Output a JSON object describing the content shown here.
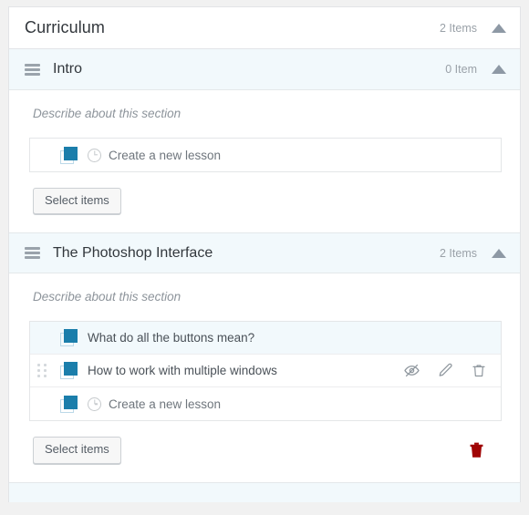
{
  "panel": {
    "title": "Curriculum",
    "item_count": "2 Items",
    "collapse_icon": "caret-up-icon"
  },
  "colors": {
    "book_icon_blue": "#1b7eab",
    "section_header_bg": "#f2f9fc",
    "delete_red": "#a00404",
    "text_primary": "#32373c",
    "text_muted": "#9aa1a8"
  },
  "sections": [
    {
      "title": "Intro",
      "item_count": "0 Item",
      "describe_placeholder": "Describe about this section",
      "lessons": [
        {
          "label": "Create a new lesson",
          "type": "placeholder",
          "has_clock": true,
          "has_handle": false,
          "highlight": false,
          "actions": []
        }
      ],
      "select_items_label": "Select items",
      "has_delete_button": false
    },
    {
      "title": "The Photoshop Interface",
      "item_count": "2 Items",
      "describe_placeholder": "Describe about this section",
      "lessons": [
        {
          "label": "What do all the buttons mean?",
          "type": "lesson",
          "has_clock": false,
          "has_handle": false,
          "highlight": true,
          "actions": []
        },
        {
          "label": "How to work with multiple windows",
          "type": "lesson",
          "has_clock": false,
          "has_handle": true,
          "highlight": false,
          "actions": [
            "eye-slash-icon",
            "pencil-icon",
            "trash-icon"
          ]
        },
        {
          "label": "Create a new lesson",
          "type": "placeholder",
          "has_clock": true,
          "has_handle": false,
          "highlight": false,
          "actions": []
        }
      ],
      "select_items_label": "Select items",
      "has_delete_button": true
    }
  ]
}
